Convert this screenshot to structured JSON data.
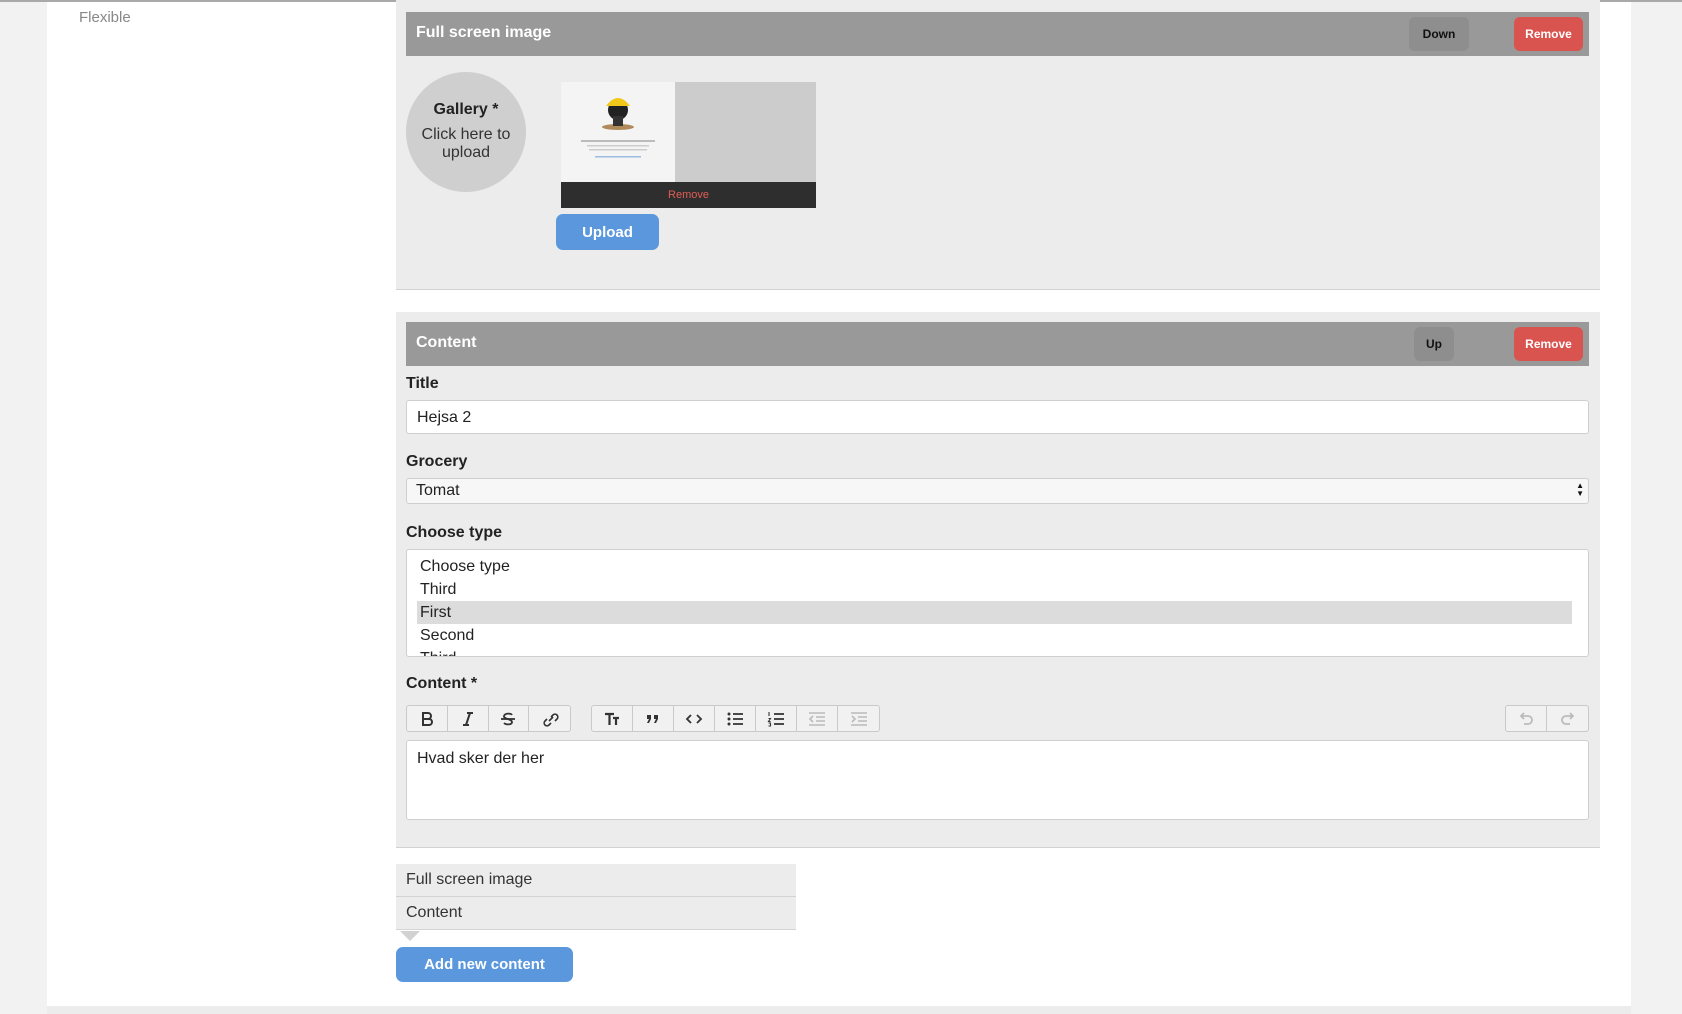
{
  "field": {
    "label": "Flexible"
  },
  "full_screen_block": {
    "title": "Full screen image",
    "down_label": "Down",
    "remove_label": "Remove",
    "gallery": {
      "title": "Gallery *",
      "hint": "Click here to upload"
    },
    "thumbnail": {
      "remove_label": "Remove"
    },
    "upload_label": "Upload"
  },
  "content_block": {
    "title": "Content",
    "up_label": "Up",
    "remove_label": "Remove",
    "title_field": {
      "label": "Title",
      "value": "Hejsa 2"
    },
    "grocery_field": {
      "label": "Grocery",
      "value": "Tomat"
    },
    "type_field": {
      "label": "Choose type",
      "options": [
        "Choose type",
        "Third",
        "First",
        "Second",
        "Third"
      ],
      "selected": "First"
    },
    "content_field": {
      "label": "Content *",
      "value": "Hvad sker der her"
    },
    "toolbar": {
      "group1": [
        "bold-icon",
        "italic-icon",
        "strikethrough-icon",
        "link-icon"
      ],
      "group2": [
        "heading-icon",
        "quote-icon",
        "code-icon",
        "bullet-list-icon",
        "number-list-icon",
        "outdent-icon",
        "indent-icon"
      ],
      "group3": [
        "undo-icon",
        "redo-icon"
      ]
    }
  },
  "add_menu": {
    "items": [
      "Full screen image",
      "Content"
    ]
  },
  "add_button_label": "Add new content"
}
